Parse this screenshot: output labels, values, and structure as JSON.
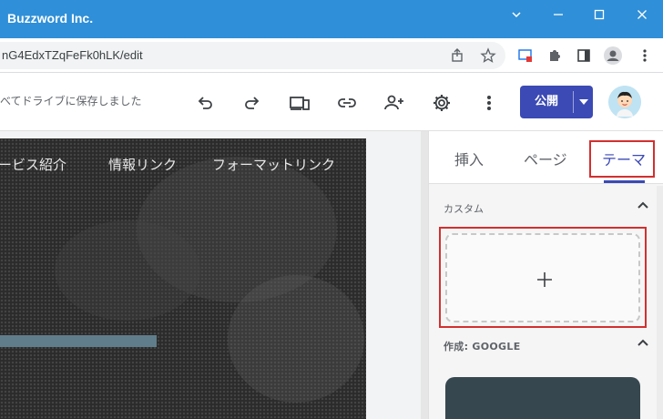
{
  "window": {
    "title": "Buzzword Inc."
  },
  "address_bar": {
    "url": "nG4EdxTZqFeFk0hLK/edit"
  },
  "toolbar": {
    "save_status": "べてドライブに保存しました",
    "publish_label": "公開"
  },
  "site_nav": {
    "items": [
      "ービス紹介",
      "情報リンク",
      "フォーマットリンク"
    ]
  },
  "panel": {
    "tabs": [
      "挿入",
      "ページ",
      "テーマ"
    ],
    "active_tab": "テーマ",
    "custom_section_title": "カスタム",
    "add_symbol": "+",
    "google_section_title": "作成: GOOGLE"
  },
  "colors": {
    "titlebar": "#2f8fd8",
    "accent": "#3b4ab4",
    "highlight": "#d32f2f",
    "hero_bg": "#2b2b2b",
    "hero_bar": "#607d8b"
  }
}
